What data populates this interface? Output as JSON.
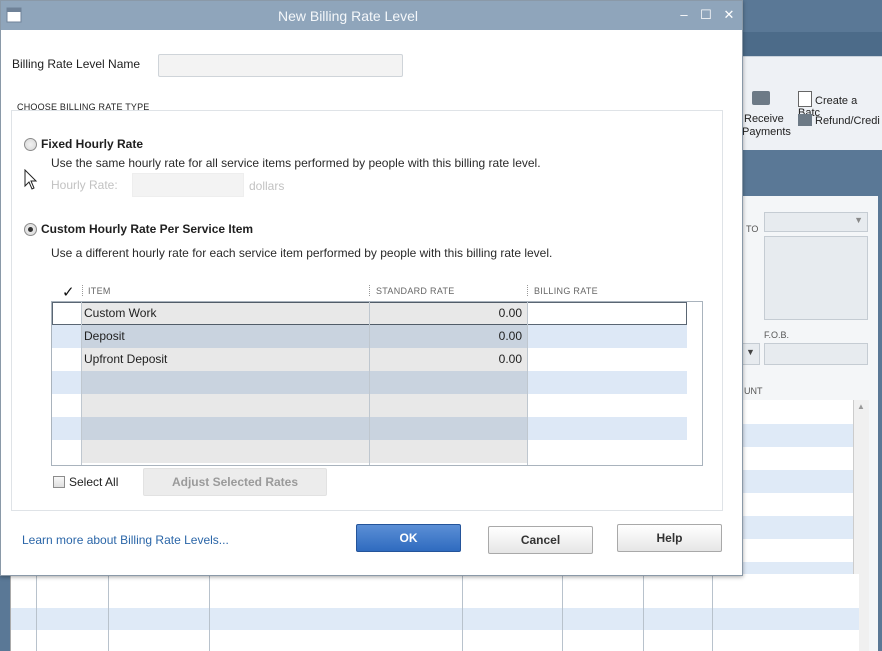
{
  "dialog": {
    "title": "New Billing Rate Level",
    "controls": {
      "minimize": "‒",
      "maximize": "☐",
      "close": "✕"
    }
  },
  "form": {
    "name_label": "Billing Rate Level Name",
    "name_value": "",
    "section_title": "CHOOSE BILLING RATE TYPE",
    "fixed": {
      "label": "Fixed Hourly Rate",
      "description": "Use the same hourly rate for all service items performed by people with this billing rate level.",
      "hourly_label": "Hourly Rate:",
      "hourly_value": "",
      "unit": "dollars",
      "selected": false
    },
    "custom": {
      "label": "Custom Hourly Rate Per Service Item",
      "description": "Use a different hourly rate for each service item performed by people with this billing rate level.",
      "selected": true
    }
  },
  "grid": {
    "check_header": "✓",
    "columns": [
      "ITEM",
      "STANDARD RATE",
      "BILLING RATE"
    ],
    "rows": [
      {
        "item": "Custom Work",
        "standard_rate": "0.00",
        "billing_rate": ""
      },
      {
        "item": "Deposit",
        "standard_rate": "0.00",
        "billing_rate": ""
      },
      {
        "item": "Upfront Deposit",
        "standard_rate": "0.00",
        "billing_rate": ""
      }
    ]
  },
  "select_all_label": "Select All",
  "adjust_button": "Adjust Selected Rates",
  "learn_more": "Learn more about Billing Rate Levels...",
  "buttons": {
    "ok": "OK",
    "cancel": "Cancel",
    "help": "Help"
  },
  "background": {
    "toolbar": {
      "create_batch": "Create a Batc",
      "receive_payments_1": "Receive",
      "receive_payments_2": "Payments",
      "refund_credit": "Refund/Credi"
    },
    "labels": {
      "to": "TO",
      "fob": "F.O.B.",
      "amount": "UNT"
    }
  },
  "colors": {
    "titlebar": "#8fa5bb",
    "accent_blue": "#2f6bbf",
    "row_alt": "#dde8f6",
    "link": "#2b66a8"
  }
}
